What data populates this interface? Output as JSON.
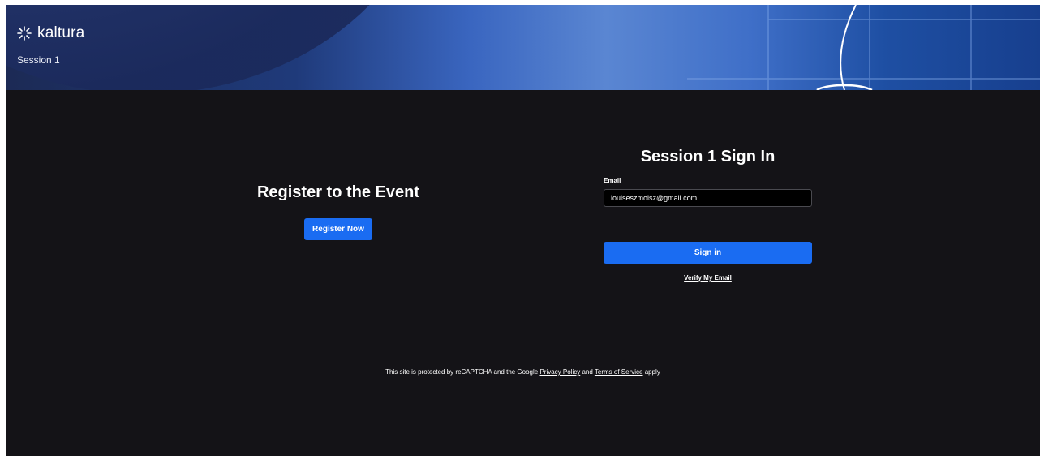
{
  "banner": {
    "logo_text": "kaltura",
    "subtitle": "Session 1",
    "logo_icon": "kaltura-sparkle-icon"
  },
  "register": {
    "title": "Register to the Event",
    "button_label": "Register Now"
  },
  "signin": {
    "title": "Session 1 Sign In",
    "email_label": "Email",
    "email_value": "louiseszmoisz@gmail.com",
    "button_label": "Sign in",
    "verify_link": "Verify My Email"
  },
  "footer": {
    "prefix": "This site is protected by reCAPTCHA and the Google ",
    "privacy_link": "Privacy Policy",
    "middle": " and ",
    "terms_link": "Terms of Service",
    "suffix": " apply"
  },
  "colors": {
    "accent": "#1a6cf2",
    "background": "#141317",
    "banner": "#3a66c0"
  }
}
